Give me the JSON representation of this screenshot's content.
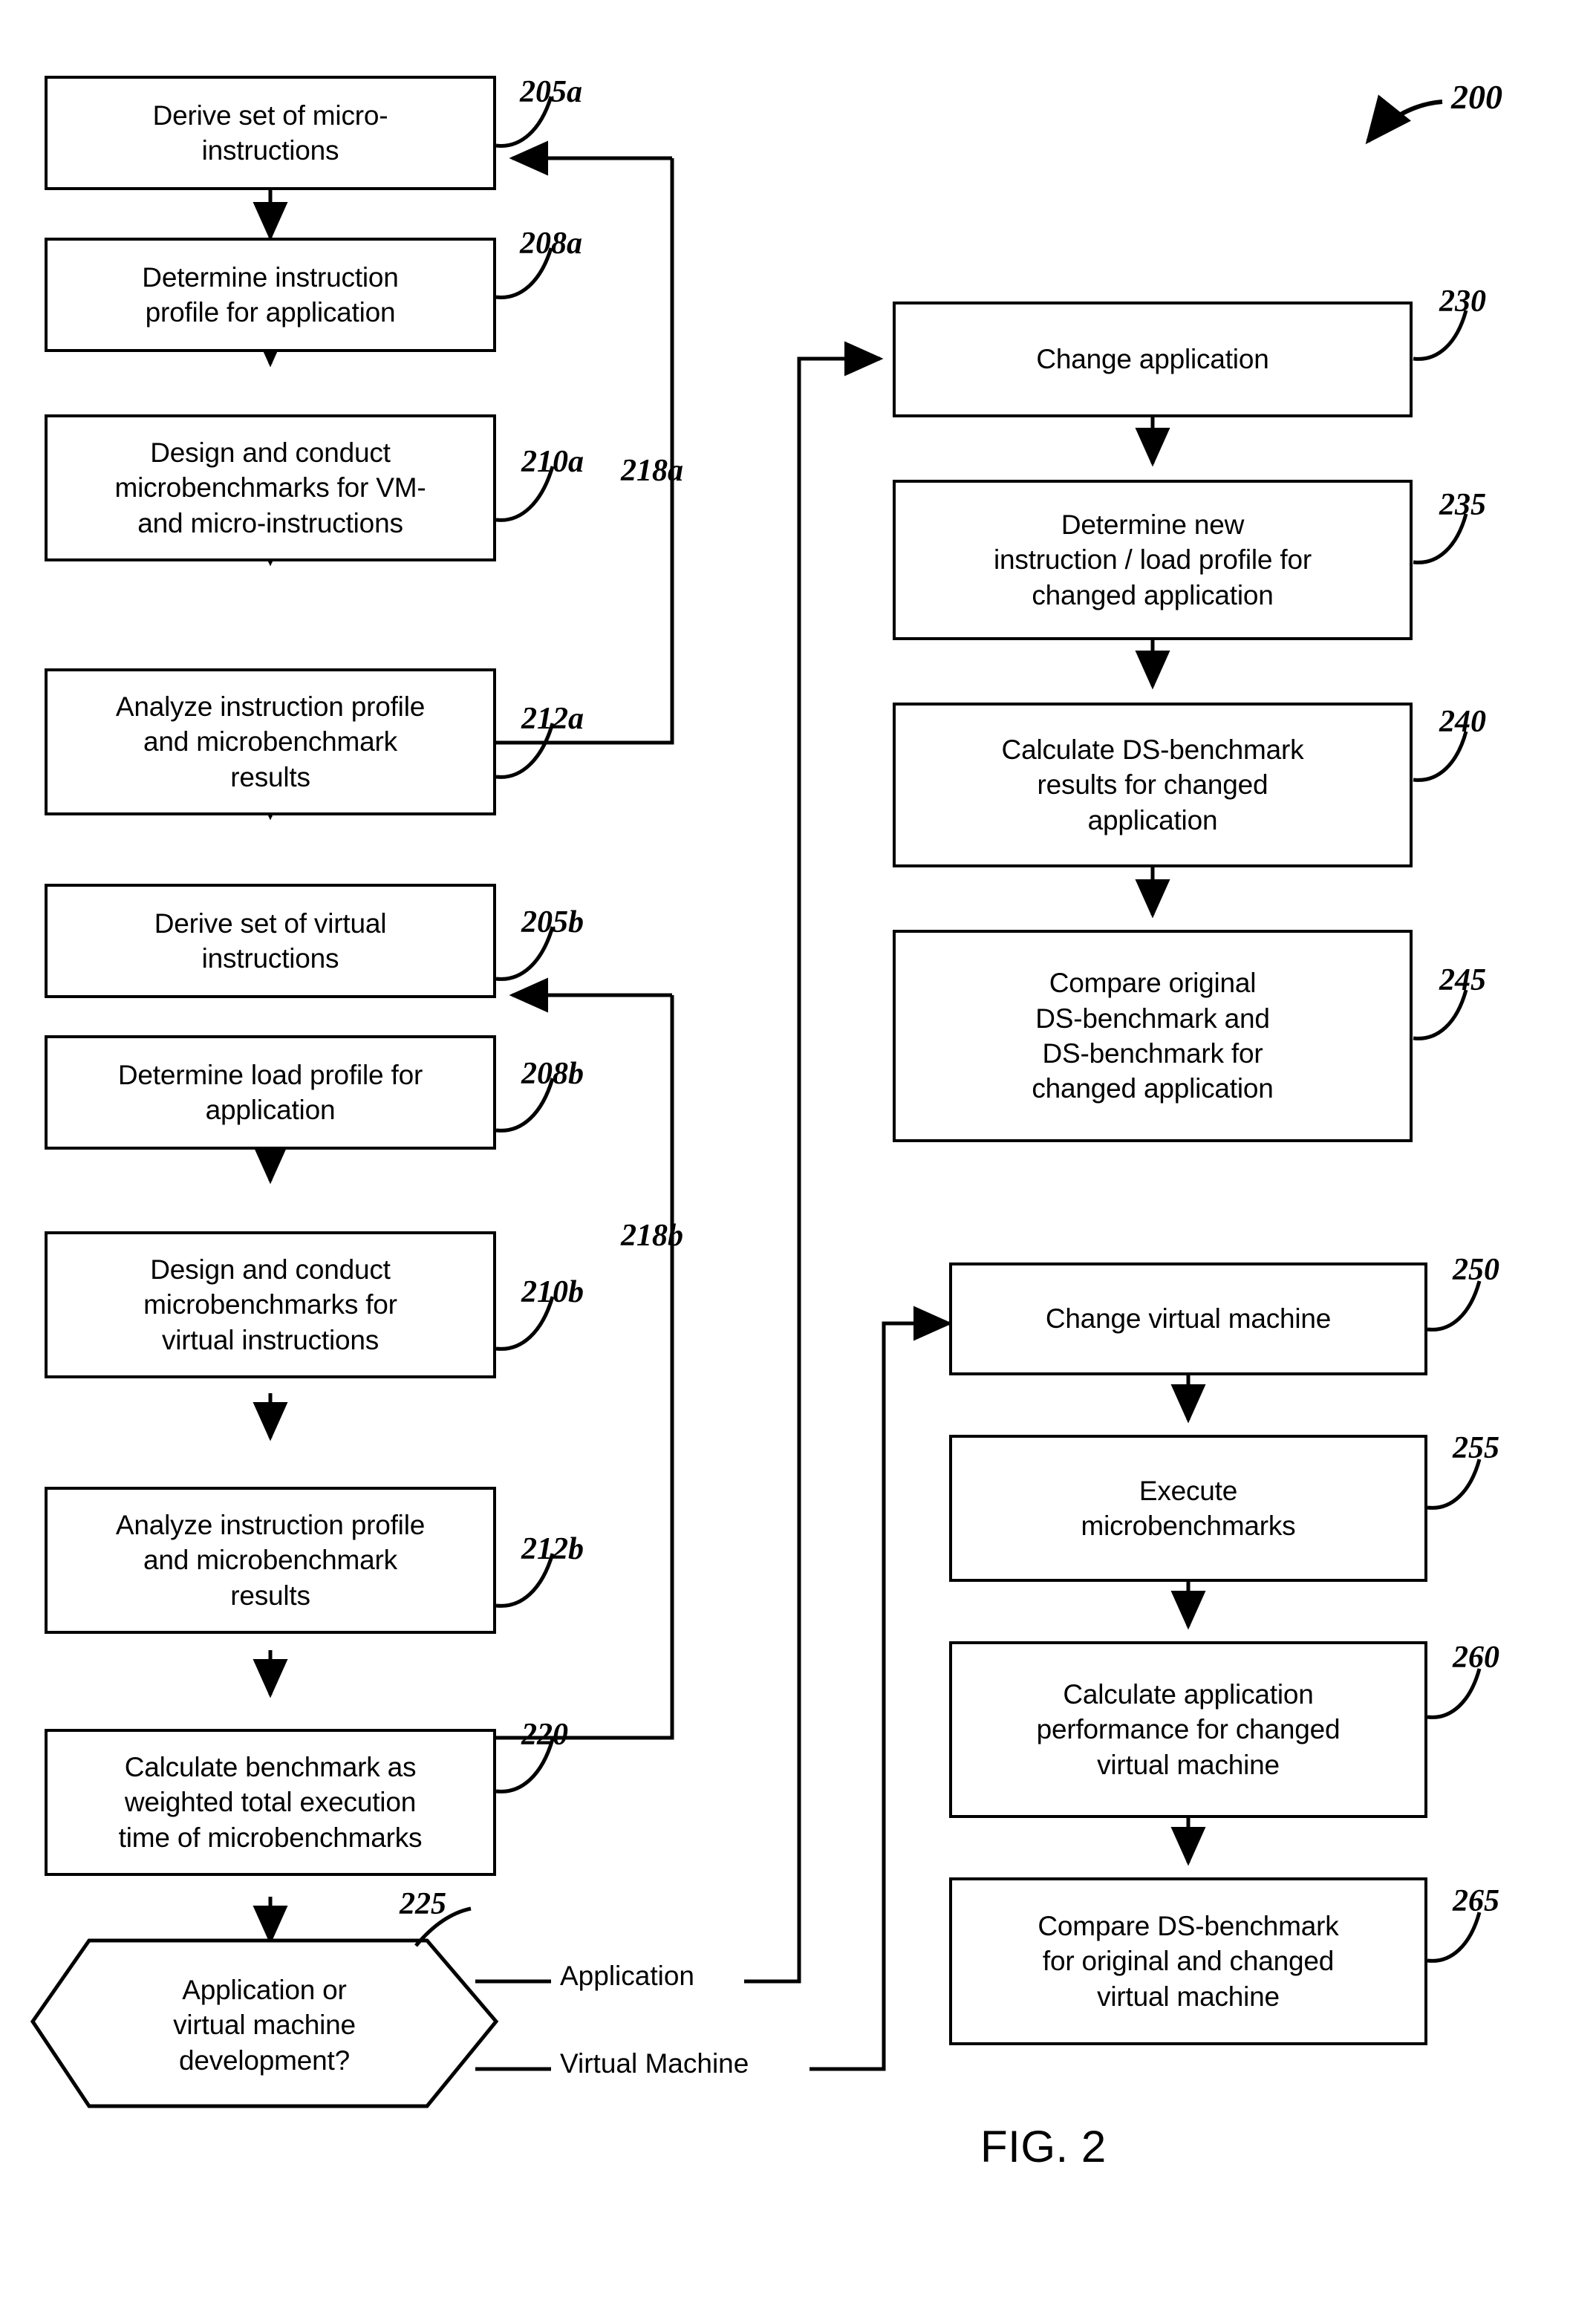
{
  "figure": {
    "caption": "FIG. 2",
    "system_ref": "200"
  },
  "left_column": {
    "nodes": [
      {
        "id": "205a",
        "ref": "205a",
        "text": "Derive set of micro-\ninstructions"
      },
      {
        "id": "208a",
        "ref": "208a",
        "text": "Determine instruction\nprofile for application"
      },
      {
        "id": "210a",
        "ref": "210a",
        "text": "Design and conduct\nmicrobenchmarks for VM-\nand micro-instructions"
      },
      {
        "id": "212a",
        "ref": "212a",
        "text": "Analyze instruction profile\nand microbenchmark\nresults"
      },
      {
        "id": "205b",
        "ref": "205b",
        "text": "Derive set of virtual\ninstructions"
      },
      {
        "id": "208b",
        "ref": "208b",
        "text": "Determine load profile for\napplication"
      },
      {
        "id": "210b",
        "ref": "210b",
        "text": "Design and conduct\nmicrobenchmarks for\nvirtual instructions"
      },
      {
        "id": "212b",
        "ref": "212b",
        "text": "Analyze instruction profile\nand microbenchmark\nresults"
      },
      {
        "id": "220",
        "ref": "220",
        "text": "Calculate benchmark as\nweighted total execution\ntime of microbenchmarks"
      },
      {
        "id": "225",
        "ref": "225",
        "text": "Application or\nvirtual machine\ndevelopment?"
      }
    ],
    "feedback_labels": [
      {
        "id": "218a",
        "ref": "218a"
      },
      {
        "id": "218b",
        "ref": "218b"
      }
    ]
  },
  "decision_branches": [
    {
      "id": "branch-application",
      "label": "Application"
    },
    {
      "id": "branch-virtual-machine",
      "label": "Virtual Machine"
    }
  ],
  "right_column_application": {
    "nodes": [
      {
        "id": "230",
        "ref": "230",
        "text": "Change application"
      },
      {
        "id": "235",
        "ref": "235",
        "text": "Determine new\ninstruction / load profile for\nchanged application"
      },
      {
        "id": "240",
        "ref": "240",
        "text": "Calculate DS-benchmark\nresults for changed\napplication"
      },
      {
        "id": "245",
        "ref": "245",
        "text": "Compare original\nDS-benchmark and\nDS-benchmark for\nchanged application"
      }
    ]
  },
  "right_column_virtual_machine": {
    "nodes": [
      {
        "id": "250",
        "ref": "250",
        "text": "Change virtual machine"
      },
      {
        "id": "255",
        "ref": "255",
        "text": "Execute\nmicrobenchmarks"
      },
      {
        "id": "260",
        "ref": "260",
        "text": "Calculate application\nperformance for changed\nvirtual machine"
      },
      {
        "id": "265",
        "ref": "265",
        "text": "Compare DS-benchmark\nfor original and changed\nvirtual machine"
      }
    ]
  },
  "colors": {
    "stroke": "#000000",
    "background": "#ffffff"
  }
}
